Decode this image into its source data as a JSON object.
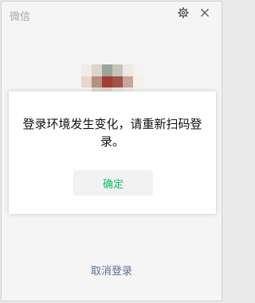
{
  "window": {
    "app_title": "微信",
    "settings_icon": "gear-icon",
    "close_icon": "close-icon"
  },
  "dialog": {
    "message": "登录环境发生变化，请重新扫码登录。",
    "confirm_label": "确定",
    "confirm_color": "#07c160"
  },
  "cancel_login_label": "取消登录",
  "cancel_color": "#56709a",
  "avatar": {
    "label": "pixelated profile picture",
    "pixels": [
      "#f2ece8",
      "#dcd6cd",
      "#9ba39a",
      "#c5c4ba",
      "#eee9e3",
      "#f6f2ee",
      "#e8d6cc",
      "#b4907e",
      "#a33e33",
      "#a35349",
      "#c8a49a",
      "#f6efea",
      "#f7f5f3",
      "#e4dcd7",
      "#ddd7d2",
      "#e9e6e3",
      "#efebe8",
      "#f7f5f3"
    ]
  }
}
